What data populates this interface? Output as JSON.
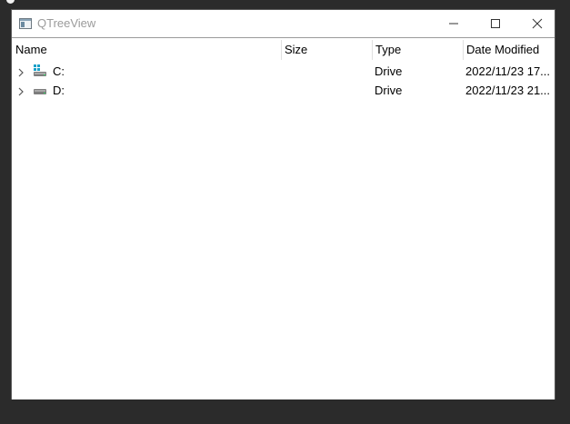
{
  "window": {
    "title": "QTreeView",
    "app_icon": "qt-window-icon",
    "controls": {
      "minimize": "minimize-icon",
      "maximize": "maximize-icon",
      "close": "close-icon"
    }
  },
  "tree": {
    "columns": [
      "Name",
      "Size",
      "Type",
      "Date Modified"
    ],
    "rows": [
      {
        "name": "C:",
        "size": "",
        "type": "Drive",
        "modified": "2022/11/23 17...",
        "icon": "system-drive-icon",
        "expander": "chevron-right-icon"
      },
      {
        "name": "D:",
        "size": "",
        "type": "Drive",
        "modified": "2022/11/23 21...",
        "icon": "drive-icon",
        "expander": "chevron-right-icon"
      }
    ]
  },
  "colors": {
    "desktop": "#2b2b2b",
    "window_bg": "#ffffff",
    "title_text": "#9b9b9b",
    "windows_logo_blue": "#1aa0c8"
  }
}
